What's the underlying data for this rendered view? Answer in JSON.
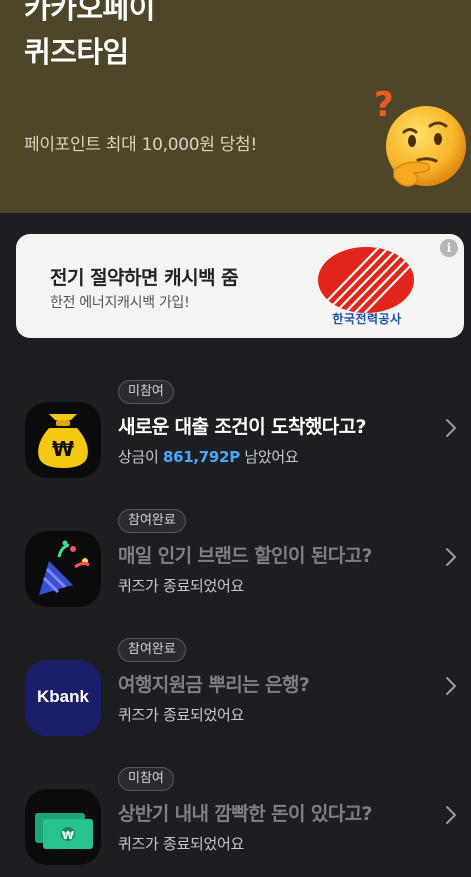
{
  "hero": {
    "title_line1": "카카오페이",
    "title_line2": "퀴즈타임",
    "subtitle": "페이포인트 최대 10,000원 당첨!"
  },
  "banner": {
    "title": "전기 절약하면 캐시백 줌",
    "subtitle": "한전 에너지캐시백 가입!",
    "logo_text": "한국전력공사",
    "info_icon": "i"
  },
  "quizzes": [
    {
      "status": "미참여",
      "title": "새로운 대출 조건이 도착했다고?",
      "sub_prefix": "상금이 ",
      "amount": "861,792P",
      "sub_suffix": " 남았어요",
      "icon": "money-bag-icon"
    },
    {
      "status": "참여완료",
      "title": "매일 인기 브랜드 할인이 된다고?",
      "sub": "퀴즈가 종료되었어요",
      "icon": "party-popper-icon"
    },
    {
      "status": "참여완료",
      "title": "여행지원금 뿌리는 은행?",
      "sub": "퀴즈가 종료되었어요",
      "icon_text": "Kbank",
      "icon": "kbank-logo-icon"
    },
    {
      "status": "미참여",
      "title": "상반기 내내 깜빡한 돈이 있다고?",
      "sub": "퀴즈가 종료되었어요",
      "icon": "banknote-icon"
    }
  ],
  "colors": {
    "hero_bg": "#4f4528",
    "page_bg": "#1d1e21",
    "amount": "#4aa8ff",
    "kepco_red": "#e1251b",
    "kbank_navy": "#1b1f6b"
  }
}
